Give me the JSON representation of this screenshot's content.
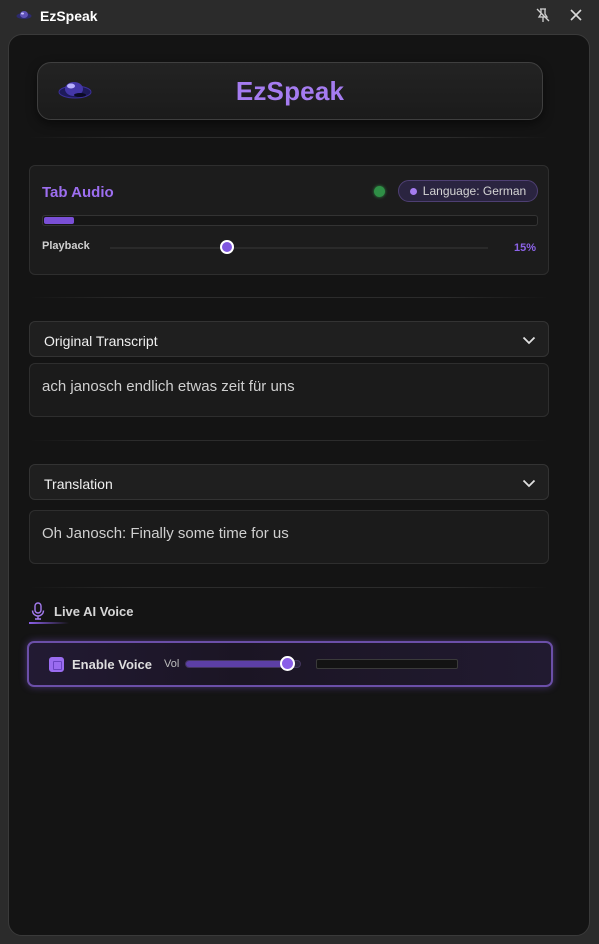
{
  "window": {
    "title": "EzSpeak"
  },
  "header": {
    "brand": "EzSpeak"
  },
  "tab_audio": {
    "title": "Tab Audio",
    "status": "active",
    "language_badge": "Language: German",
    "level": 0.06,
    "playback_label": "Playback",
    "playback_position": 0.31,
    "playback_percent": "15%"
  },
  "transcript": {
    "header": "Original Transcript",
    "text": "ach janosch endlich etwas zeit für uns"
  },
  "translation": {
    "header": "Translation",
    "text": "Oh Janosch: Finally some time for us"
  },
  "live_voice": {
    "label": "Live AI Voice",
    "enable_label": "Enable Voice",
    "enabled": true,
    "vol_label": "Vol",
    "volume": 0.88,
    "meter_level": 0
  },
  "colors": {
    "accent": "#a57cf0",
    "accent_dark": "#7a4fd6",
    "status_green": "#2f8f46",
    "panel_bg": "#141414"
  },
  "icons": {
    "app": "ufo-icon",
    "pin": "pin-off-icon",
    "close": "close-icon",
    "chevron": "chevron-down-icon",
    "mic": "microphone-icon"
  }
}
